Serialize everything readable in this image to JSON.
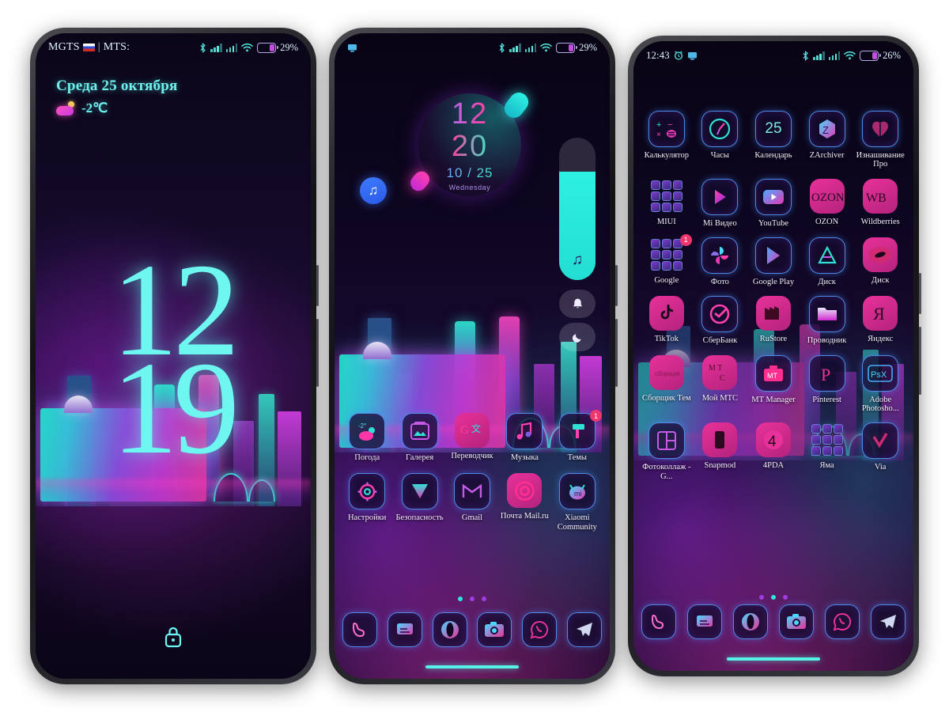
{
  "theme": {
    "accent_cyan": "#6ef7f0",
    "accent_magenta": "#ff3fa0",
    "accent_purple": "#a13ce0",
    "badge_color": "#f0366f"
  },
  "phone_lock": {
    "status_bar": {
      "carrier_primary": "MGTS",
      "carrier_separator": "|",
      "carrier_secondary": "MTS:",
      "flag_icon": "ru-flag-icon",
      "bluetooth_icon": "bluetooth-icon",
      "signal_icon_1": "signal-bars-icon",
      "signal_icon_2": "signal-bars-icon",
      "wifi_icon": "wifi-icon",
      "battery_icon": "battery-icon",
      "battery_percent": "29%"
    },
    "date": "Среда 25 октября",
    "weather_icon": "partly-cloudy-icon",
    "temperature": "-2℃",
    "clock_hours": "12",
    "clock_minutes": "19",
    "lock_icon": "lock-icon"
  },
  "phone_home": {
    "status_bar": {
      "screenshot_icon": "screenshot-icon",
      "bluetooth_icon": "bluetooth-icon",
      "signal_icon_1": "signal-bars-icon",
      "signal_icon_2": "signal-bars-icon",
      "wifi_icon": "wifi-icon",
      "battery_icon": "battery-icon",
      "battery_percent": "29%"
    },
    "clock_widget": {
      "hours": "12",
      "minutes": "20",
      "date": "10 / 25",
      "weekday": "Wednesday"
    },
    "floating_music_icon": "music-note-icon",
    "volume_slider": {
      "icon": "music-note-icon",
      "level_percent": 76
    },
    "side_buttons": [
      {
        "icon": "bell-icon",
        "name": "notification-toggle"
      },
      {
        "icon": "moon-icon",
        "name": "dark-mode-toggle"
      }
    ],
    "apps": [
      {
        "label": "Погода",
        "icon": "weather-icon",
        "badge": null
      },
      {
        "label": "Галерея",
        "icon": "gallery-icon",
        "badge": null
      },
      {
        "label": "Переводчик",
        "icon": "translate-icon",
        "badge": null
      },
      {
        "label": "Музыка",
        "icon": "music-icon",
        "badge": null
      },
      {
        "label": "Темы",
        "icon": "themes-icon",
        "badge": "1"
      },
      {
        "label": "Настройки",
        "icon": "settings-gear-icon",
        "badge": null
      },
      {
        "label": "Безопасность",
        "icon": "security-shield-icon",
        "badge": null
      },
      {
        "label": "Gmail",
        "icon": "gmail-icon",
        "badge": null
      },
      {
        "label": "Почта Mail.ru",
        "icon": "mailru-icon",
        "badge": null
      },
      {
        "label": "Xiaomi Community",
        "icon": "xiaomi-mi-icon",
        "badge": null
      }
    ],
    "page_dots": {
      "count": 3,
      "active_index": 0
    },
    "dock": [
      {
        "label": "Телефон",
        "icon": "phone-icon"
      },
      {
        "label": "Сообщения",
        "icon": "messages-icon"
      },
      {
        "label": "Opera",
        "icon": "opera-icon"
      },
      {
        "label": "Камера",
        "icon": "camera-icon"
      },
      {
        "label": "WhatsApp",
        "icon": "whatsapp-icon"
      },
      {
        "label": "Telegram",
        "icon": "telegram-icon"
      }
    ]
  },
  "phone_apps": {
    "status_bar": {
      "time": "12:43",
      "alarm_icon": "alarm-clock-icon",
      "screenshot_icon": "screenshot-icon",
      "bluetooth_icon": "bluetooth-icon",
      "signal_icon_1": "signal-bars-icon",
      "signal_icon_2": "signal-bars-icon",
      "wifi_icon": "wifi-icon",
      "battery_icon": "battery-icon",
      "battery_percent": "26%"
    },
    "apps": [
      {
        "label": "Калькулятор",
        "icon": "calculator-icon",
        "badge": null
      },
      {
        "label": "Часы",
        "icon": "clock-icon",
        "badge": null
      },
      {
        "label": "Календарь",
        "icon": "calendar-icon",
        "day": "25",
        "badge": null
      },
      {
        "label": "ZArchiver",
        "icon": "zarchiver-icon",
        "badge": null
      },
      {
        "label": "Изнашивание Про",
        "icon": "wear-pro-icon",
        "badge": null
      },
      {
        "label": "MIUI",
        "icon": "folder-grid-icon",
        "badge": null
      },
      {
        "label": "Mi Видео",
        "icon": "mi-video-icon",
        "badge": null
      },
      {
        "label": "YouTube",
        "icon": "youtube-icon",
        "badge": null
      },
      {
        "label": "OZON",
        "icon": "ozon-icon",
        "badge": null
      },
      {
        "label": "Wildberries",
        "icon": "wildberries-icon",
        "badge": null
      },
      {
        "label": "Google",
        "icon": "folder-grid-icon",
        "badge": "1"
      },
      {
        "label": "Фото",
        "icon": "google-photos-icon",
        "badge": null
      },
      {
        "label": "Google Play",
        "icon": "google-play-icon",
        "badge": null
      },
      {
        "label": "Диск",
        "icon": "google-drive-icon",
        "badge": null
      },
      {
        "label": "Диск",
        "icon": "disk-icon",
        "badge": null
      },
      {
        "label": "TikTok",
        "icon": "tiktok-icon",
        "badge": null
      },
      {
        "label": "СберБанк",
        "icon": "sberbank-icon",
        "badge": null
      },
      {
        "label": "RuStore",
        "icon": "rustore-icon",
        "badge": null
      },
      {
        "label": "Проводник",
        "icon": "file-manager-icon",
        "badge": null
      },
      {
        "label": "Яндекс",
        "icon": "yandex-icon",
        "badge": null
      },
      {
        "label": "Сборщик Тем",
        "icon": "theme-builder-icon",
        "badge": null
      },
      {
        "label": "Мой МТС",
        "icon": "mts-icon",
        "badge": null
      },
      {
        "label": "MT Manager",
        "icon": "mt-manager-icon",
        "badge": null
      },
      {
        "label": "Pinterest",
        "icon": "pinterest-icon",
        "badge": null
      },
      {
        "label": "Adobe Photosho...",
        "icon": "photoshop-express-icon",
        "badge": null
      },
      {
        "label": "Фотоколлаж - G...",
        "icon": "photo-collage-icon",
        "badge": null
      },
      {
        "label": "Snapmod",
        "icon": "snapmod-icon",
        "badge": null
      },
      {
        "label": "4PDA",
        "icon": "fourpda-icon",
        "badge": null
      },
      {
        "label": "Яма",
        "icon": "folder-grid-icon",
        "badge": null
      },
      {
        "label": "Via",
        "icon": "via-browser-icon",
        "badge": null
      }
    ],
    "page_dots": {
      "count": 3,
      "active_index": 1
    },
    "dock": [
      {
        "label": "Телефон",
        "icon": "phone-icon"
      },
      {
        "label": "Сообщения",
        "icon": "messages-icon"
      },
      {
        "label": "Opera",
        "icon": "opera-icon"
      },
      {
        "label": "Камера",
        "icon": "camera-icon"
      },
      {
        "label": "WhatsApp",
        "icon": "whatsapp-icon"
      },
      {
        "label": "Telegram",
        "icon": "telegram-icon"
      }
    ]
  }
}
